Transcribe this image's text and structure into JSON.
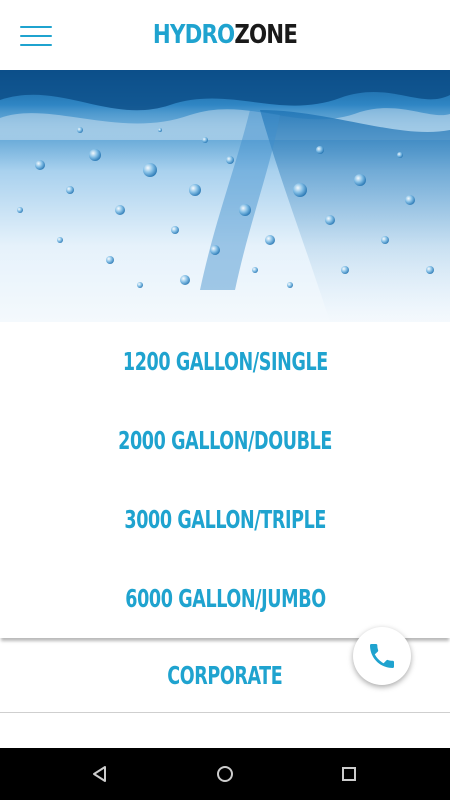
{
  "header": {
    "brand_part1": "HYDRO",
    "brand_part2": "ZONE",
    "accent_color": "#1fa3cf",
    "menu_icon": "hamburger-menu-icon"
  },
  "hero": {
    "image": "water-splash-bubbles"
  },
  "menu": {
    "items": [
      {
        "label": "1200 GALLON/SINGLE"
      },
      {
        "label": "2000 GALLON/DOUBLE"
      },
      {
        "label": "3000 GALLON/TRIPLE"
      },
      {
        "label": "6000 GALLON/JUMBO"
      },
      {
        "label": "CORPORATE"
      }
    ]
  },
  "fab": {
    "icon": "phone-icon",
    "color": "#1fa3cf"
  },
  "system_nav": {
    "back_icon": "back-triangle-icon",
    "home_icon": "home-circle-icon",
    "recents_icon": "recents-square-icon"
  }
}
